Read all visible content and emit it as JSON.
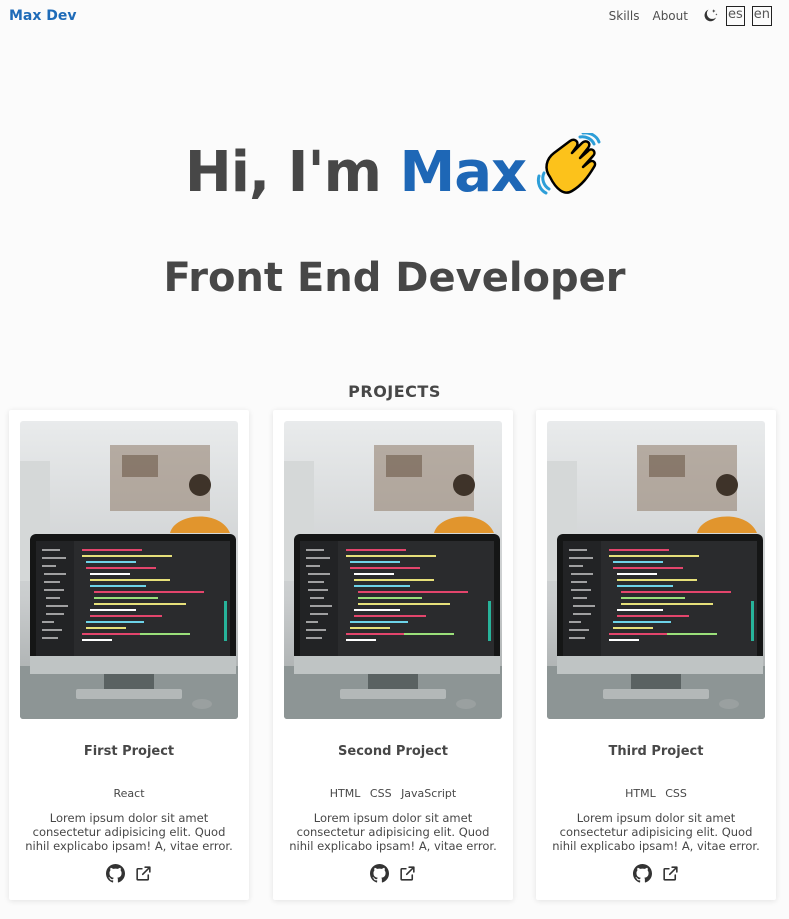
{
  "header": {
    "brand": "Max Dev",
    "nav": [
      "Skills",
      "About"
    ],
    "theme_toggle_icon": "moon-stars-icon",
    "languages": [
      "es",
      "en"
    ]
  },
  "hero": {
    "greeting": "Hi, I'm ",
    "name": "Max",
    "emoji": "waving-hand-icon",
    "role": "Front End Developer"
  },
  "projects": {
    "title": "PROJECTS",
    "items": [
      {
        "title": "First Project",
        "tags": [
          "React"
        ],
        "description": "Lorem ipsum dolor sit amet consectetur adipisicing elit. Quod nihil explicabo ipsam! A, vitae error.",
        "links": [
          "github-icon",
          "external-link-icon"
        ]
      },
      {
        "title": "Second Project",
        "tags": [
          "HTML",
          "CSS",
          "JavaScript"
        ],
        "description": "Lorem ipsum dolor sit amet consectetur adipisicing elit. Quod nihil explicabo ipsam! A, vitae error.",
        "links": [
          "github-icon",
          "external-link-icon"
        ]
      },
      {
        "title": "Third Project",
        "tags": [
          "HTML",
          "CSS"
        ],
        "description": "Lorem ipsum dolor sit amet consectetur adipisicing elit. Quod nihil explicabo ipsam! A, vitae error.",
        "links": [
          "github-icon",
          "external-link-icon"
        ]
      }
    ]
  },
  "colors": {
    "accent": "#1e67b6",
    "text": "#474747",
    "background": "#fbfbfb"
  }
}
